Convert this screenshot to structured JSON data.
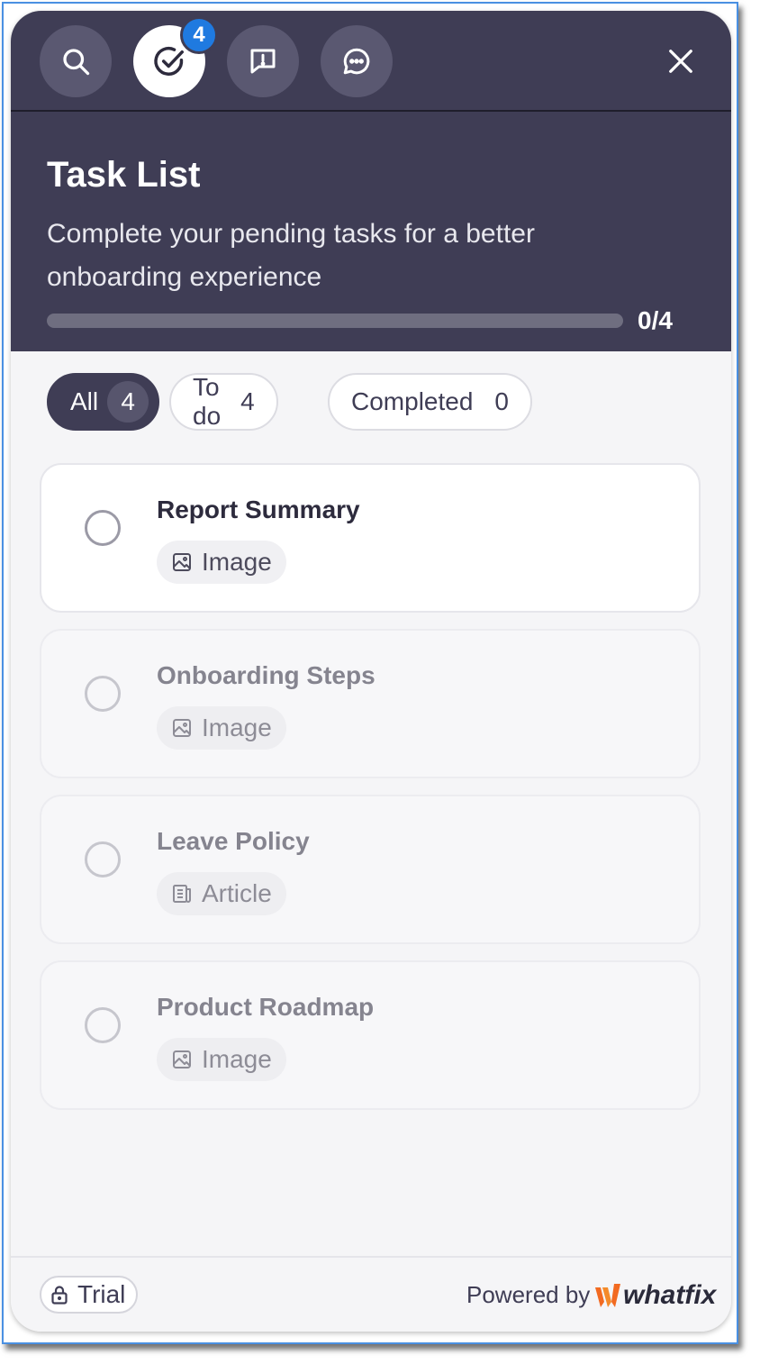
{
  "toolbar": {
    "icons": [
      "search-icon",
      "task-check-icon",
      "feedback-icon",
      "chat-icon"
    ],
    "active_index": 1,
    "badge": "4",
    "close_icon": "close-icon"
  },
  "header": {
    "title": "Task List",
    "subtitle": "Complete your pending tasks for a better onboarding experience",
    "progress_label": "0/4",
    "progress_fraction": 0
  },
  "filters": [
    {
      "label": "All",
      "count": "4",
      "active": true
    },
    {
      "label": "To do",
      "count": "4",
      "active": false
    },
    {
      "label": "Completed",
      "count": "0",
      "active": false
    }
  ],
  "tasks": [
    {
      "name": "Report Summary",
      "tag": "Image",
      "tag_icon": "image-icon"
    },
    {
      "name": "Onboarding Steps",
      "tag": "Image",
      "tag_icon": "image-icon"
    },
    {
      "name": "Leave Policy",
      "tag": "Article",
      "tag_icon": "article-icon"
    },
    {
      "name": "Product Roadmap",
      "tag": "Image",
      "tag_icon": "image-icon"
    }
  ],
  "footer": {
    "trial_label": "Trial",
    "powered_by": "Powered by",
    "brand": "whatfix"
  },
  "colors": {
    "header_bg": "#3f3d55",
    "badge": "#1f7ae0",
    "brand_accent": "#f26a21"
  }
}
